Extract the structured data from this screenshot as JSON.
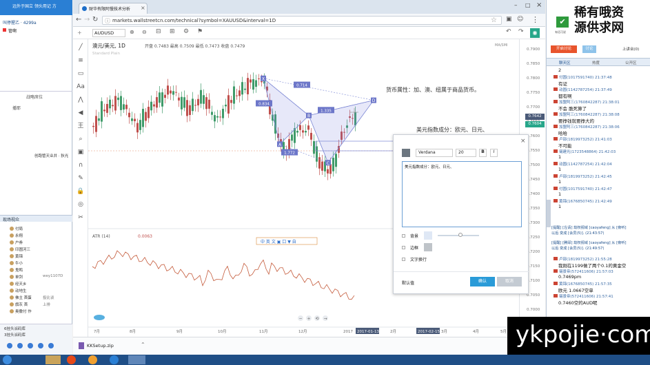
{
  "left_app": {
    "title": "远外于国立 领头用记 方",
    "hall": "叫停猩乙 · 4299a",
    "speaker": "管啊",
    "section1": "战略席位",
    "section2": "播耶",
    "notice": "创跑管天业井 · 狄光",
    "list_title": "现场视众",
    "users": [
      "付局",
      "永翔",
      "户券",
      "印圆河三",
      "黄锦",
      "牛小",
      "鬼鸭",
      "单剑",
      "经天乡",
      "动地生",
      "佛主 首蛋",
      "旗灰 首",
      "奥撒付 作"
    ],
    "user_extra": [
      "",
      "",
      "",
      "",
      "",
      "",
      "",
      "wey1107D",
      "",
      "",
      "投比谈",
      "上排",
      ""
    ],
    "footer1": "6挂头派码库",
    "footer2": "3挂头派码库"
  },
  "browser": {
    "tab_title": "财华有限阿慢技术分析",
    "url": "markets.wallstreetcn.com/technical?symbol=XAUUSD&interval=1D",
    "tv_symbol": "AUDUSD",
    "download_file": "KKSetup.zip"
  },
  "chart_data": {
    "type": "candlestick",
    "title": "澳元/美元",
    "interval": "1D",
    "ohlc_label": "开盘 0.7483  最高 0.7509  最低 0.7473  收盘 0.7479",
    "sub_header": "Standard Plain",
    "y_ticks": [
      "0.7900",
      "0.7850",
      "0.7800",
      "0.7750",
      "0.7700",
      "0.7650",
      "0.7600",
      "0.7550",
      "0.7500",
      "0.7450",
      "0.7400",
      "0.7350",
      "0.7300",
      "0.7250",
      "0.7200",
      "0.7150",
      "0.7100",
      "0.7050",
      "0.7000",
      "0.6950",
      "0.6900"
    ],
    "price_badges": [
      "0.7642",
      "0.7604"
    ],
    "top_right_label": "MA/SMI",
    "x_ticks": [
      "7月",
      "8月",
      "9月",
      "10月",
      "11月",
      "12月",
      "2017",
      "2017-01-13",
      "2月",
      "2017-02-15",
      "3月",
      "4月",
      "5月"
    ],
    "indicator_label": "ATR (14)",
    "indicator_value": "0.0063",
    "pattern_points": [
      "X",
      "A",
      "B",
      "C",
      "D"
    ],
    "pattern_ratios": [
      "0.834",
      "0.714",
      "1.335",
      "1.772"
    ],
    "annotation1": "货币属性：加、澳、纽属于商品货币。",
    "annotation2": "美元指数成分：欧元、日元、",
    "indicator_toolbar": "中 英 文 ▣ 口 ▼ 自"
  },
  "dialog": {
    "font": "Verdana",
    "size": "20",
    "bold": "B",
    "italic": "I",
    "text": "美元指数成分：欧元、日元、",
    "background_label": "背景",
    "border_label": "边框",
    "wrap_label": "文字换行",
    "default_btn": "默认值",
    "ok_btn": "确认",
    "cancel_btn": "取消",
    "close": "×"
  },
  "right_app": {
    "banner_line1": "稀有哦资",
    "banner_line2": "源供求网",
    "check_label": "有话可说",
    "btn1": "开启讨论",
    "btn2": "讨论",
    "btn3": "上讲台(0)",
    "tabs": [
      "聊天区",
      "热度",
      "公开区"
    ],
    "messages": [
      {
        "name": "",
        "time": "",
        "text": "2"
      },
      {
        "name": "付圆(1017591740)",
        "time": "21:37:48",
        "text": "有证"
      },
      {
        "name": "动圆(1142787254)",
        "time": "21:37:49",
        "text": "都有啊"
      },
      {
        "name": "加盟阿三(1760842287)",
        "time": "21:38:01",
        "text": "不会   脆死算了"
      },
      {
        "name": "加盟阿三(1760842287)",
        "time": "21:38:08",
        "text": "要挣钱就要挣大的"
      },
      {
        "name": "加盟阿三(1760842287)",
        "time": "21:38:06",
        "text": "哈哈"
      },
      {
        "name": "卢部(1819973252)",
        "time": "21:41:03",
        "text": "不可能"
      },
      {
        "name": "锡建光(1723548864)",
        "time": "21:42:03",
        "text": "1"
      },
      {
        "name": "动圆(1142787254)",
        "time": "21:42:04",
        "text": "1"
      },
      {
        "name": "卢部(1819973252)",
        "time": "21:42:45",
        "text": "1"
      },
      {
        "name": "付圆(1017591740)",
        "time": "21:42:47",
        "text": "1"
      },
      {
        "name": "黄锦(1676850745)",
        "time": "21:42:49",
        "text": "1"
      }
    ],
    "sys1": "[提醒] [左请] 劫权视域 [caoyafeng] 从 [旁听]",
    "sys1b": "以后 变成 [会员(5)]. (21:43:57)",
    "sys2": "[提醒] [腾邱] 劫权视域 [caoyafeng] 从 [旁听]",
    "sys2b": "以后 变成 [会员(5)]. (21:49:57)",
    "messages2": [
      {
        "name": "卢部(1819973252)",
        "time": "21:55:28",
        "text": "我刚在1199做了两个0.1的黄金空"
      },
      {
        "name": "锡景帝(572411606)",
        "time": "21:57:03",
        "text": "0.7469pm"
      },
      {
        "name": "黄锦(1676850745)",
        "time": "21:57:35",
        "text": "欧元 1.0667空单"
      },
      {
        "name": "锡景帝(572411606)",
        "time": "21:57:41",
        "text": "0.7460空的AUD呢"
      }
    ],
    "watermark": "ykpojie·com"
  }
}
